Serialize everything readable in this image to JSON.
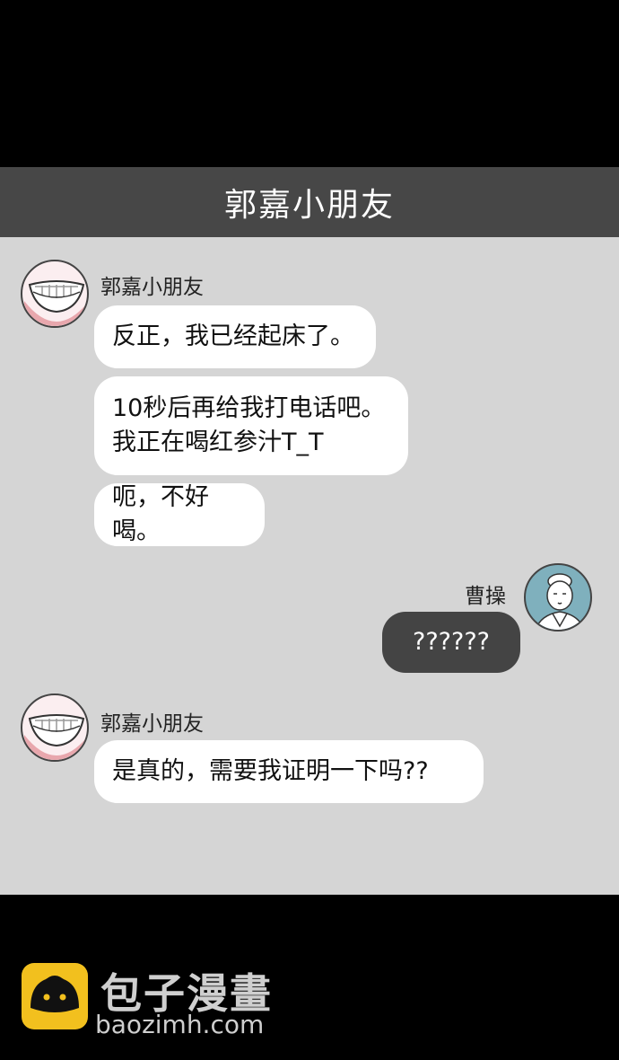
{
  "header": {
    "title": "郭嘉小朋友"
  },
  "messages": [
    {
      "sender": "郭嘉小朋友",
      "bubbles": [
        "反正，我已经起床了。",
        "10秒后再给我打电话吧。\n我正在喝红参汁T_T",
        "呃，不好喝。"
      ]
    },
    {
      "sender": "曹操",
      "bubbles": [
        "??????"
      ]
    },
    {
      "sender": "郭嘉小朋友",
      "bubbles": [
        "是真的，需要我证明一下吗??"
      ]
    }
  ],
  "watermark": {
    "name": "包子漫畫",
    "url": "baozimh.com"
  },
  "colors": {
    "header_bg": "#474747",
    "chat_bg": "#d5d5d5",
    "outgoing_bubble": "#444444",
    "incoming_bubble": "#ffffff",
    "logo_yellow": "#f2c01e"
  }
}
